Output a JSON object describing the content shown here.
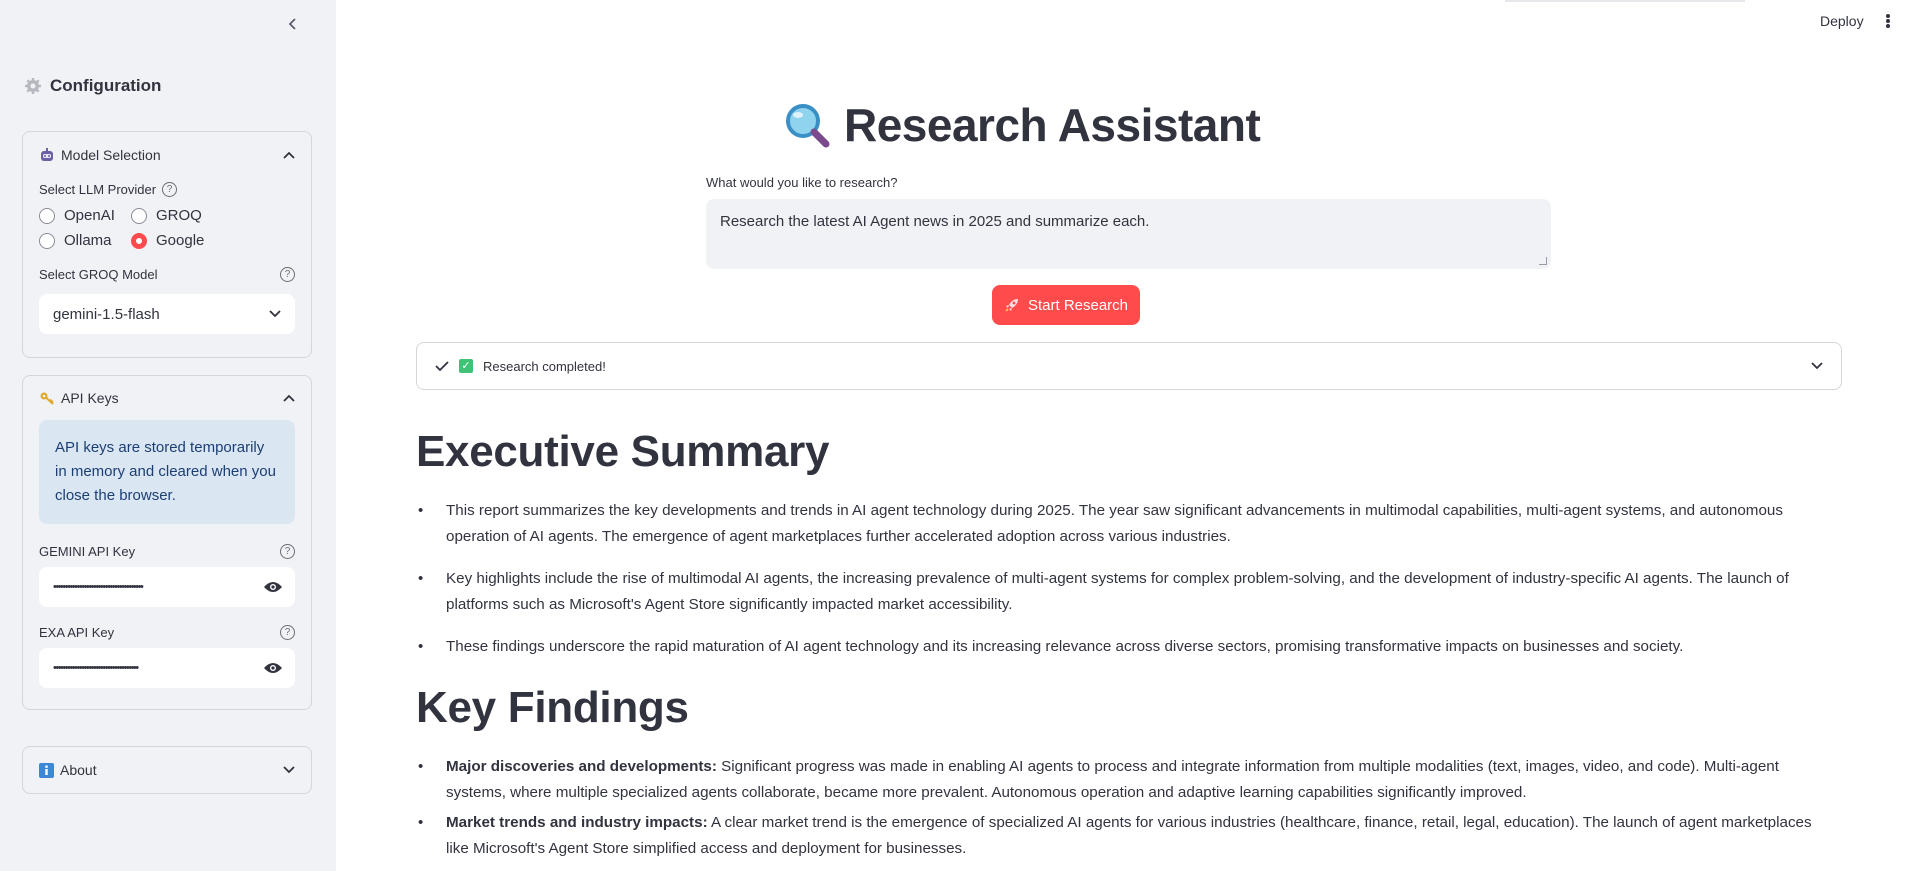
{
  "sidebar": {
    "title": "Configuration",
    "model_section": {
      "title": "Model Selection",
      "provider_label": "Select LLM Provider",
      "providers": [
        {
          "label": "OpenAI",
          "selected": false
        },
        {
          "label": "GROQ",
          "selected": false
        },
        {
          "label": "Ollama",
          "selected": false
        },
        {
          "label": "Google",
          "selected": true
        }
      ],
      "model_label": "Select GROQ Model",
      "model_value": "gemini-1.5-flash"
    },
    "api_section": {
      "title": "API Keys",
      "info": "API keys are stored temporarily in memory and cleared when you close the browser.",
      "gemini_label": "GEMINI API Key",
      "gemini_value": "••••••••••••••••••••••••••••••••••••••",
      "exa_label": "EXA API Key",
      "exa_value": "••••••••••••••••••••••••••••••••••••"
    },
    "about_section": {
      "title": "About"
    }
  },
  "header": {
    "deploy_label": "Deploy"
  },
  "main": {
    "title": "Research Assistant",
    "query_label": "What would you like to research?",
    "query_value": "Research the latest AI Agent news in 2025 and summarize each.",
    "start_label": "Start Research",
    "status_text": "Research completed!",
    "exec_summary": {
      "heading": "Executive Summary",
      "items": [
        "This report summarizes the key developments and trends in AI agent technology during 2025. The year saw significant advancements in multimodal capabilities, multi-agent systems, and autonomous operation of AI agents. The emergence of agent marketplaces further accelerated adoption across various industries.",
        "Key highlights include the rise of multimodal AI agents, the increasing prevalence of multi-agent systems for complex problem-solving, and the development of industry-specific AI agents. The launch of platforms such as Microsoft's Agent Store significantly impacted market accessibility.",
        "These findings underscore the rapid maturation of AI agent technology and its increasing relevance across diverse sectors, promising transformative impacts on businesses and society."
      ]
    },
    "key_findings": {
      "heading": "Key Findings",
      "items": [
        {
          "bold": "Major discoveries and developments:",
          "text": " Significant progress was made in enabling AI agents to process and integrate information from multiple modalities (text, images, video, and code). Multi-agent systems, where multiple specialized agents collaborate, became more prevalent. Autonomous operation and adaptive learning capabilities significantly improved."
        },
        {
          "bold": "Market trends and industry impacts:",
          "text": " A clear market trend is the emergence of specialized AI agents for various industries (healthcare, finance, retail, legal, education). The launch of agent marketplaces like Microsoft's Agent Store simplified access and deployment for businesses."
        }
      ]
    }
  },
  "colors": {
    "accent": "#ff4b4b",
    "sidebar_bg": "#f0f2f6",
    "info_bg": "#dbe6f3",
    "success": "#3ec276"
  },
  "icons": [
    "chevron-left-icon",
    "gear-icon",
    "robot-icon",
    "help-icon",
    "chevron-down-icon",
    "chevron-up-icon",
    "key-icon",
    "eye-icon",
    "info-icon",
    "magnifier-icon",
    "rocket-icon",
    "check-icon",
    "kebab-menu-icon"
  ]
}
